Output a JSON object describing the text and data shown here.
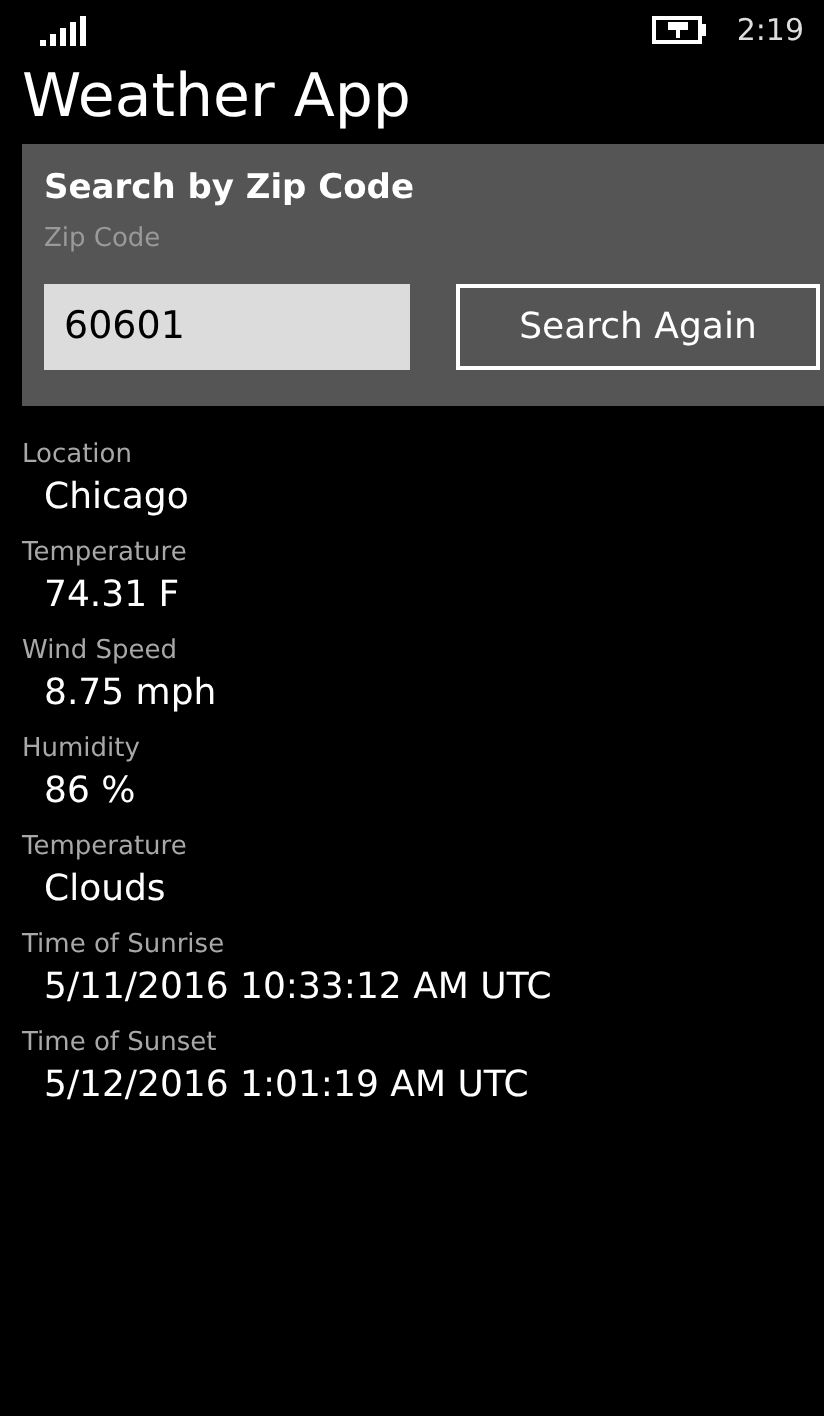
{
  "status_bar": {
    "time": "2:19"
  },
  "title": "Weather App",
  "search_panel": {
    "heading": "Search by Zip Code",
    "field_label": "Zip Code",
    "zip_value": "60601",
    "button": "Search Again"
  },
  "fields": [
    {
      "label": "Location",
      "value": "Chicago"
    },
    {
      "label": "Temperature",
      "value": "74.31 F"
    },
    {
      "label": "Wind Speed",
      "value": "8.75 mph"
    },
    {
      "label": "Humidity",
      "value": "86 %"
    },
    {
      "label": "Temperature",
      "value": "Clouds"
    },
    {
      "label": "Time of Sunrise",
      "value": "5/11/2016 10:33:12 AM UTC"
    },
    {
      "label": "Time of Sunset",
      "value": "5/12/2016 1:01:19 AM UTC"
    }
  ]
}
